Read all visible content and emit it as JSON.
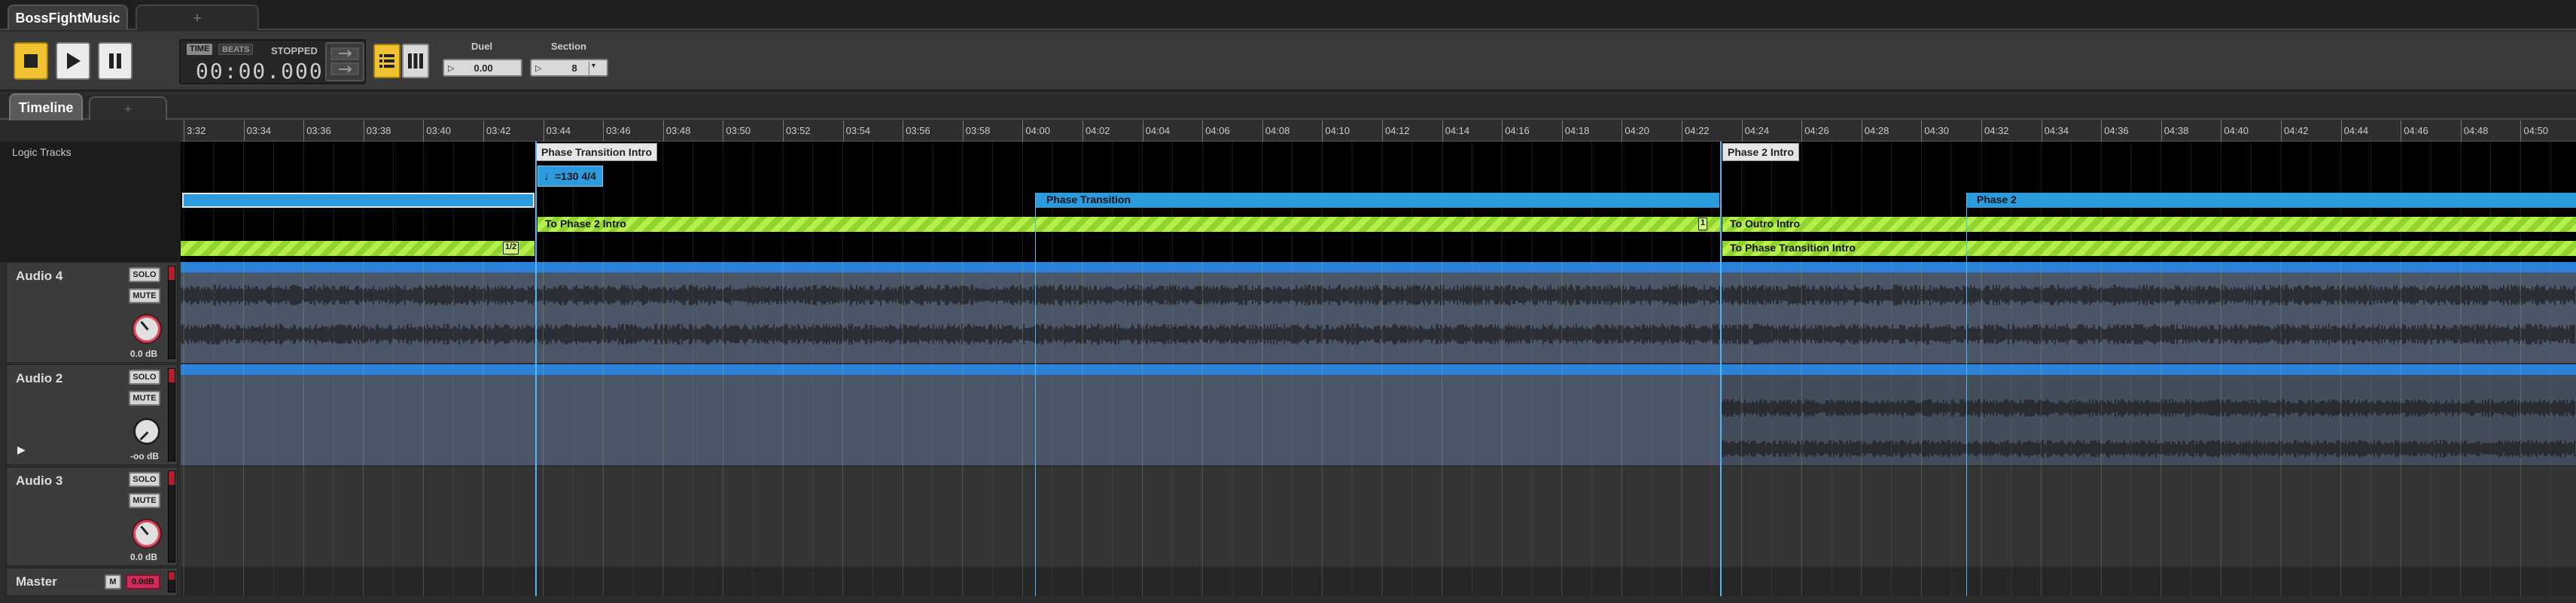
{
  "tabs": {
    "project": "BossFightMusic",
    "add": "+"
  },
  "transport": {
    "time_pill": "TIME",
    "beats_pill": "BEATS",
    "state": "STOPPED",
    "time": "00:00.000",
    "duel_label": "Duel",
    "duel_value": "0.00",
    "section_label": "Section",
    "section_value": "8"
  },
  "view_tabs": {
    "timeline": "Timeline",
    "add": "+"
  },
  "ruler": {
    "labels": [
      "3:32",
      "03:34",
      "03:36",
      "03:38",
      "03:40",
      "03:42",
      "03:44",
      "03:46",
      "03:48",
      "03:50",
      "03:52",
      "03:54",
      "03:56",
      "03:58",
      "04:00",
      "04:02",
      "04:04",
      "04:06",
      "04:08",
      "04:10",
      "04:12",
      "04:14",
      "04:16",
      "04:18",
      "04:20",
      "04:22",
      "04:24",
      "04:26",
      "04:28",
      "04:30",
      "04:32",
      "04:34",
      "04:36",
      "04:38",
      "04:40",
      "04:42",
      "04:44",
      "04:46",
      "04:48",
      "04:50"
    ]
  },
  "logic": {
    "label": "Logic Tracks",
    "markers": [
      "Phase Transition Intro",
      "Phase 2 Intro"
    ],
    "tempo": "♩=130 4/4",
    "blue_regions": [
      "",
      "Phase Transition",
      "Phase 2"
    ],
    "green_regions": [
      "To Phase 2 Intro",
      "To Outro Intro",
      "To Phase Transition Intro"
    ],
    "badges": [
      "1/2",
      "1"
    ]
  },
  "tracks": [
    {
      "name": "Audio 4",
      "solo": "SOLO",
      "mute": "MUTE",
      "volume": "0.0 dB"
    },
    {
      "name": "Audio 2",
      "solo": "SOLO",
      "mute": "MUTE",
      "volume": "-oo dB"
    },
    {
      "name": "Audio 3",
      "solo": "SOLO",
      "mute": "MUTE",
      "volume": "0.0 dB"
    }
  ],
  "master": {
    "name": "Master",
    "mute": "M",
    "level": "0.0dB"
  },
  "colors": {
    "accent": "#f1c232",
    "region_blue": "#2b9bde",
    "region_green": "#8fd431",
    "playhead": "#4fb8f1",
    "meter_red": "#b1202b"
  }
}
